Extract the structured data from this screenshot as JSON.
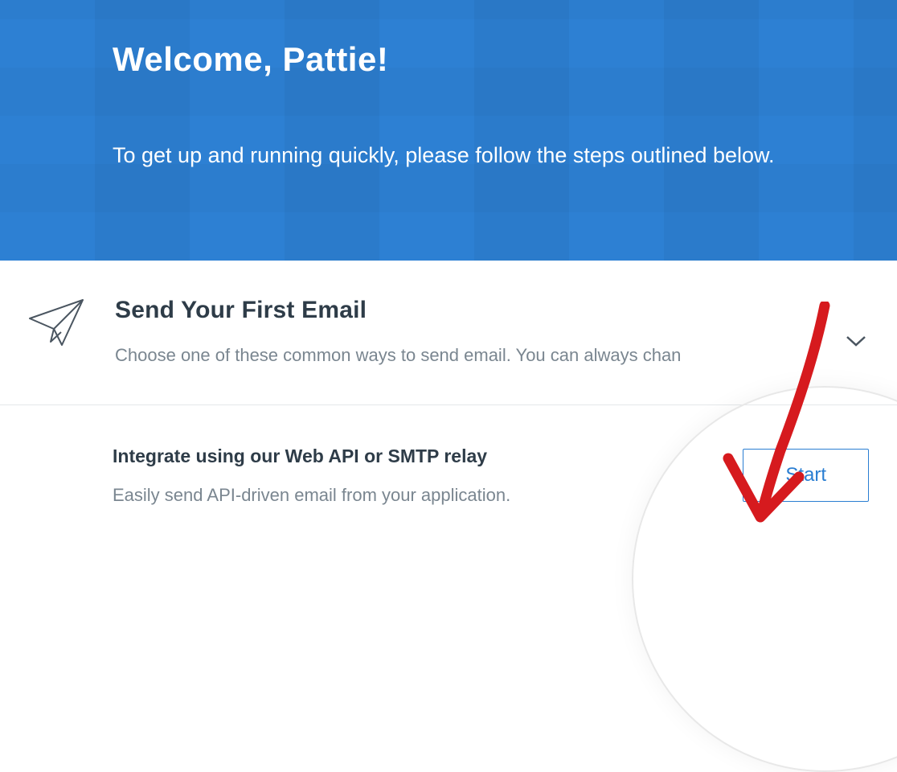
{
  "header": {
    "welcome_title": "Welcome, Pattie!",
    "welcome_subtitle": "To get up and running quickly, please follow the steps outlined below."
  },
  "send_section": {
    "title": "Send Your First Email",
    "description": "Choose one of these common ways to send email. You can always chan"
  },
  "integrate_section": {
    "title": "Integrate using our Web API or SMTP relay",
    "description": "Easily send API-driven email from your application.",
    "start_label": "Start"
  }
}
